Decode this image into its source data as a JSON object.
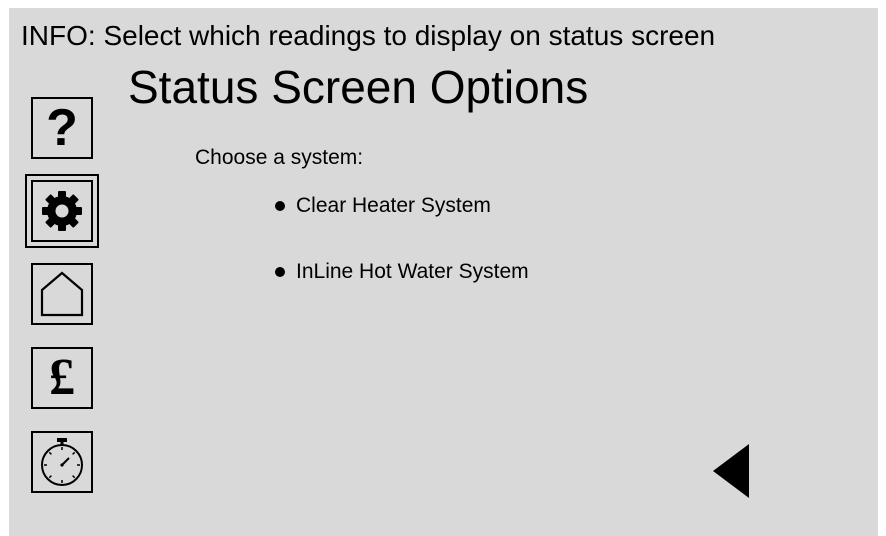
{
  "info": {
    "text": "INFO: Select which readings to display on status screen"
  },
  "page": {
    "title": "Status Screen Options",
    "prompt": "Choose a system:"
  },
  "options": [
    {
      "label": "Clear Heater System"
    },
    {
      "label": "InLine Hot Water System"
    }
  ],
  "sidebar": {
    "items": [
      {
        "icon": "help-icon",
        "glyph": "?",
        "selected": false
      },
      {
        "icon": "gear-icon",
        "selected": true
      },
      {
        "icon": "home-icon",
        "selected": false
      },
      {
        "icon": "pound-icon",
        "glyph": "£",
        "selected": false
      },
      {
        "icon": "stopwatch-icon",
        "selected": false
      }
    ]
  },
  "controls": {
    "back_icon": "back-arrow-icon"
  },
  "colors": {
    "background": "#d9d9d9",
    "foreground": "#000000",
    "outer": "#ffffff"
  }
}
